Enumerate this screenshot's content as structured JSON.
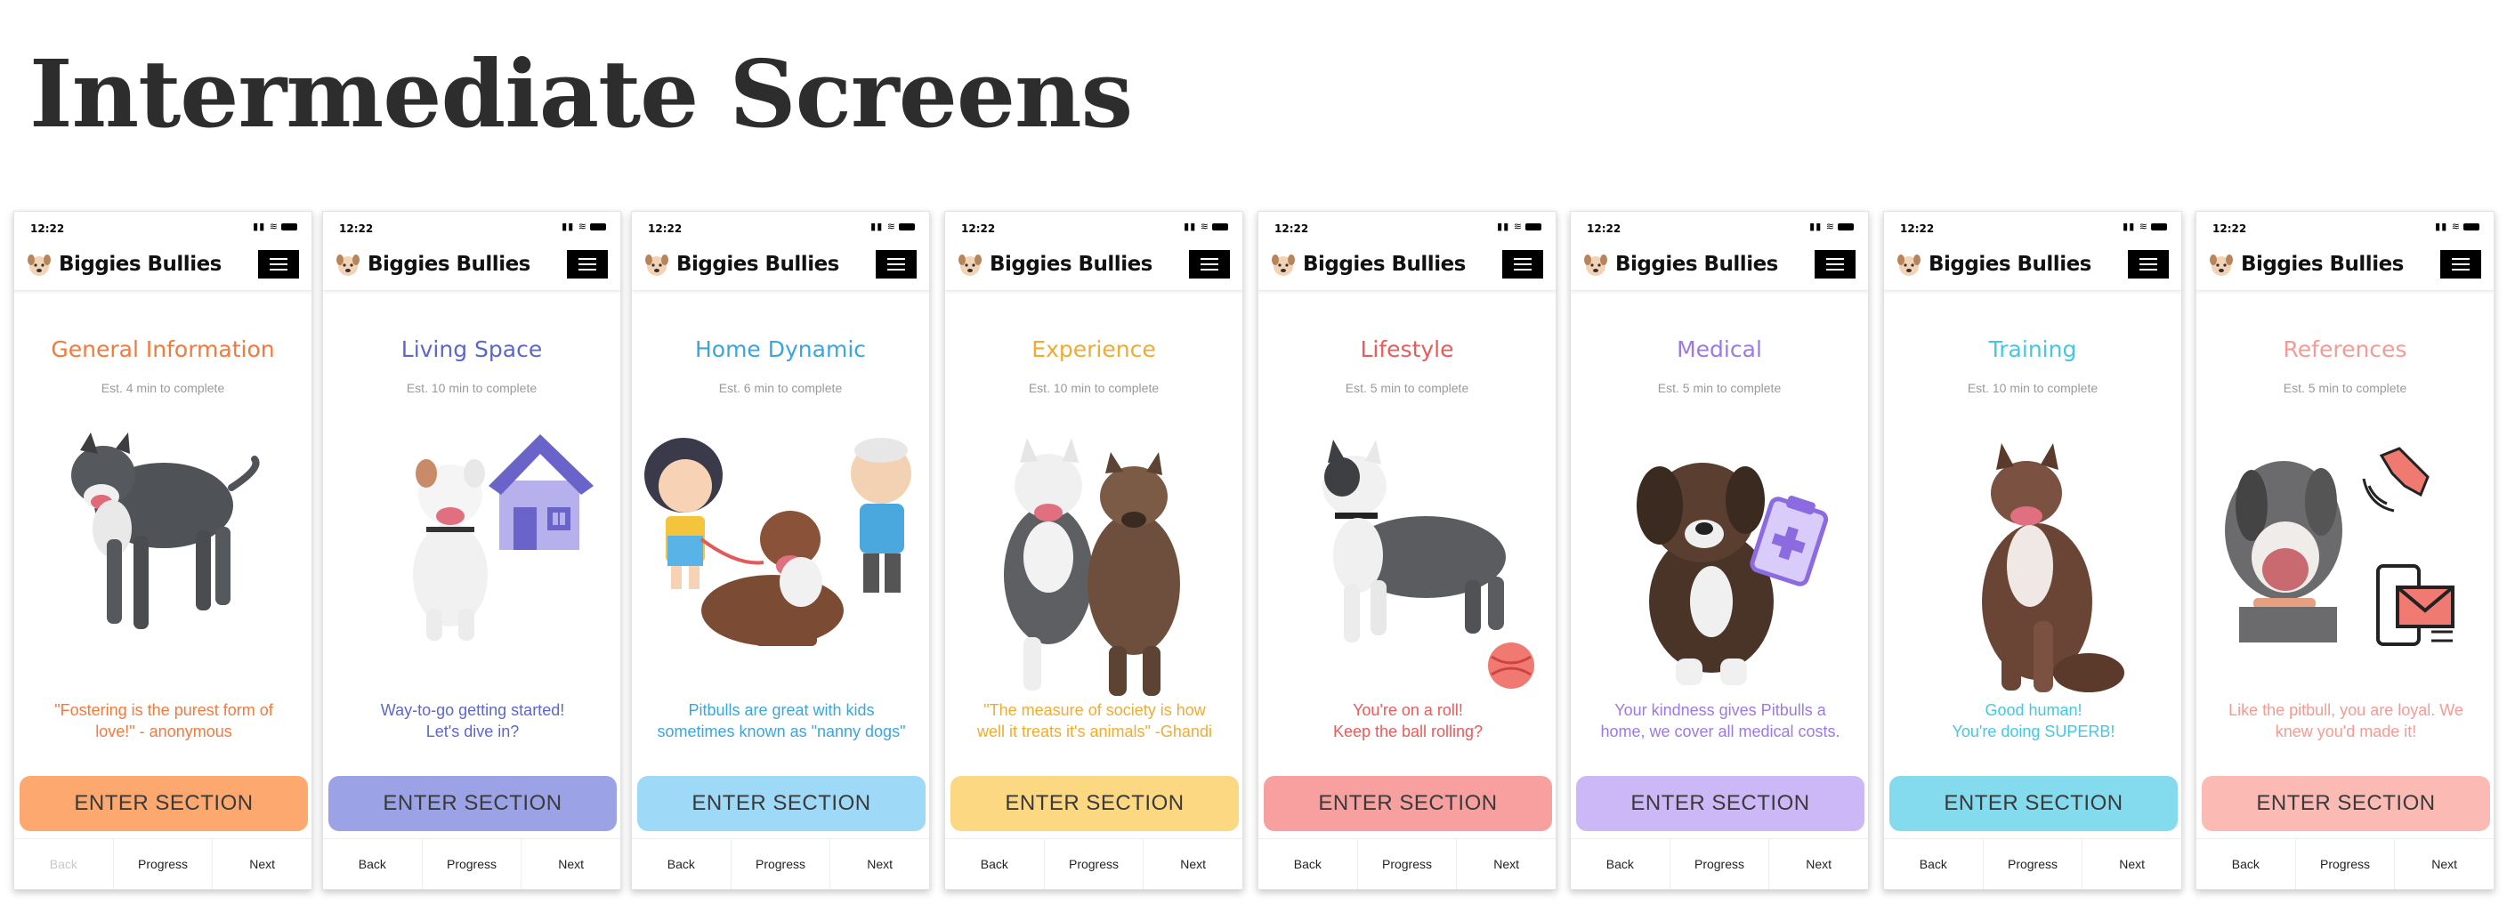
{
  "page": {
    "title": "Intermediate Screens"
  },
  "common": {
    "status_time": "12:22",
    "app_name": "Biggies Bullies",
    "enter_label": "ENTER SECTION",
    "nav": {
      "back": "Back",
      "progress": "Progress",
      "next": "Next"
    }
  },
  "screens": [
    {
      "title": "General Information",
      "time": "Est. 4 min to complete",
      "quote": "\"Fostering is the purest form of\nlove!\" - anonymous",
      "accent": "#f47a3c",
      "button_color": "#fca86f",
      "back_disabled": true
    },
    {
      "title": "Living Space",
      "time": "Est. 10 min to complete",
      "quote": "Way-to-go getting started!\nLet's dive in?",
      "accent": "#5d66d0",
      "button_color": "#9ba3e6",
      "back_disabled": false
    },
    {
      "title": "Home Dynamic",
      "time": "Est. 6 min to complete",
      "quote": "Pitbulls are great with kids\nsometimes known as \"nanny dogs\"",
      "accent": "#3aa6dd",
      "button_color": "#9ed9f7",
      "back_disabled": false
    },
    {
      "title": "Experience",
      "time": "Est. 10 min to complete",
      "quote": "\"The measure of society is how\nwell it treats it's animals\" -Ghandi",
      "accent": "#f2ab31",
      "button_color": "#fcd883",
      "back_disabled": false
    },
    {
      "title": "Lifestyle",
      "time": "Est. 5 min to complete",
      "quote": "You're on a roll!\nKeep the ball rolling?",
      "accent": "#ec5a5a",
      "button_color": "#f8a0a0",
      "back_disabled": false
    },
    {
      "title": "Medical",
      "time": "Est. 5 min to complete",
      "quote": "Your kindness gives Pitbulls a\nhome, we cover all medical costs.",
      "accent": "#9b79e6",
      "button_color": "#ccb8f7",
      "back_disabled": false
    },
    {
      "title": "Training",
      "time": "Est. 10 min to complete",
      "quote": "Good human!\nYou're doing SUPERB!",
      "accent": "#44c7e3",
      "button_color": "#84dbee",
      "back_disabled": false
    },
    {
      "title": "References",
      "time": "Est. 5 min to complete",
      "quote": "Like the pitbull, you are loyal.   We\nknew you'd made it!",
      "accent": "#f59b93",
      "button_color": "#fbbbb4",
      "back_disabled": false
    }
  ],
  "illustrations": [
    "dog-standing-icon",
    "dog-with-house-icon",
    "dog-with-family-icon",
    "two-dogs-icon",
    "dog-with-ball-icon",
    "puppy-with-clipboard-icon",
    "dog-sitting-icon",
    "dog-with-phone-mail-icon"
  ]
}
